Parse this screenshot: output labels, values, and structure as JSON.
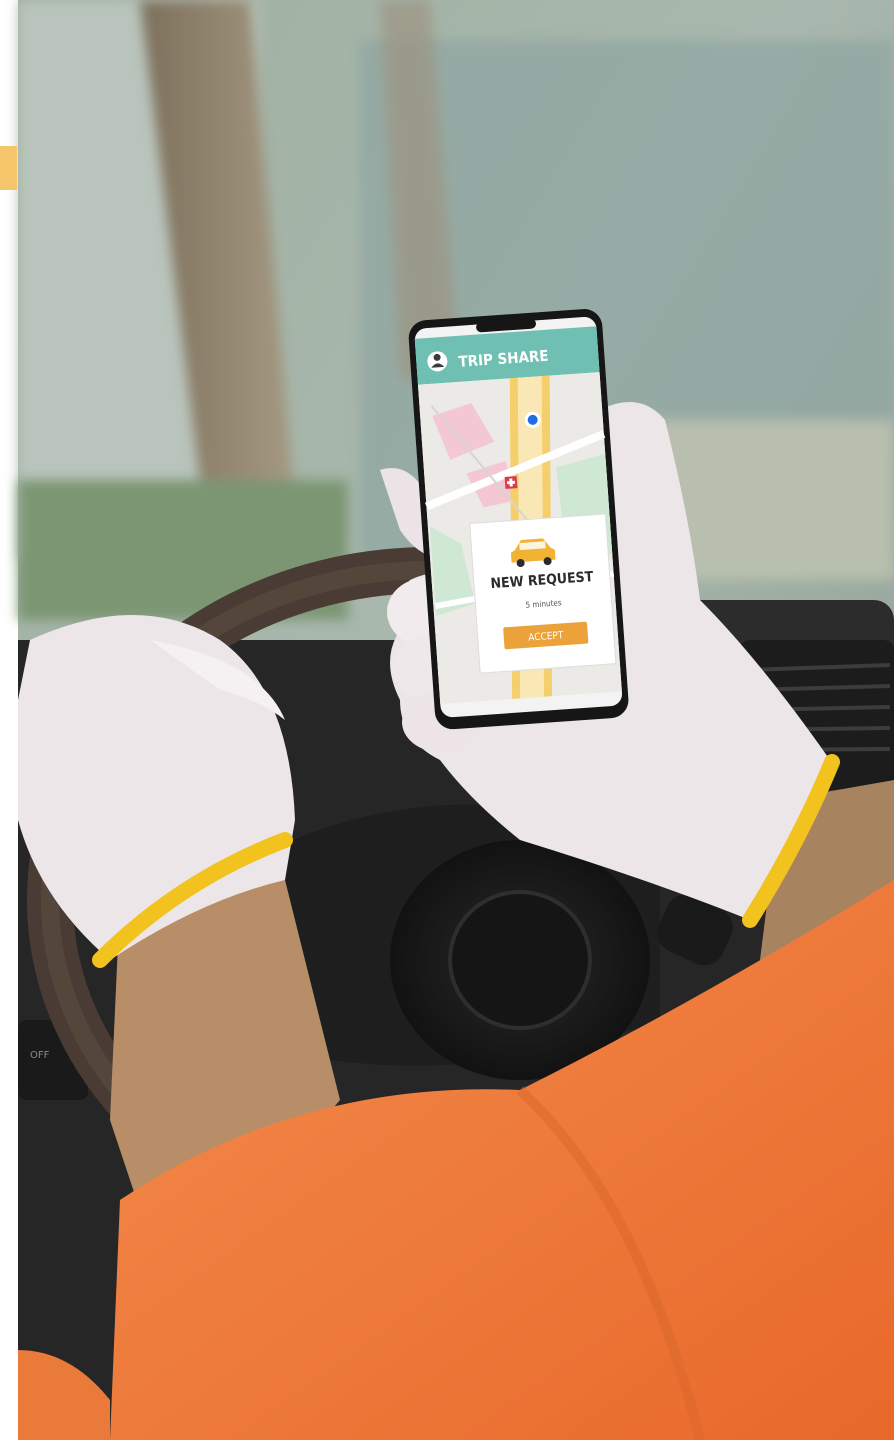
{
  "app": {
    "title": "TRIP SHARE",
    "request_title": "NEW REQUEST",
    "eta": "5 minutes",
    "accept_label": "ACCEPT"
  },
  "colors": {
    "accent_tab": "#F6C66B",
    "app_header": "#6FC0B3",
    "accept_button": "#EBA23B",
    "car_icon": "#F2B233",
    "shirt": "#EF7E3E",
    "glove_cuff": "#F2C21E"
  },
  "icons": {
    "profile": "user-avatar-icon",
    "location": "location-pin-icon",
    "hospital": "hospital-marker-icon",
    "car": "car-icon"
  }
}
